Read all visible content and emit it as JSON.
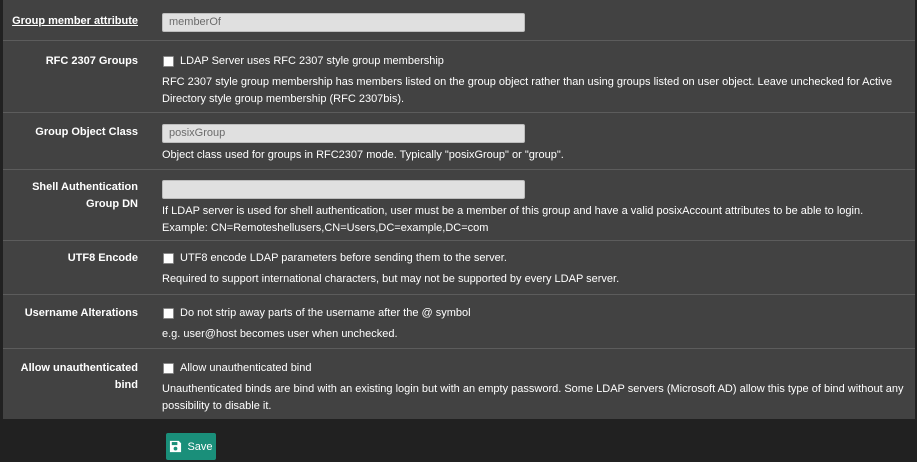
{
  "rows": {
    "group_member_attribute": {
      "label": "Group member attribute",
      "value": "memberOf"
    },
    "rfc2307_groups": {
      "label": "RFC 2307 Groups",
      "checkbox_label": "LDAP Server uses RFC 2307 style group membership",
      "checked": false,
      "help": "RFC 2307 style group membership has members listed on the group object rather than using groups listed on user object. Leave unchecked for Active Directory style group membership (RFC 2307bis)."
    },
    "group_object_class": {
      "label": "Group Object Class",
      "value": "posixGroup",
      "help": "Object class used for groups in RFC2307 mode. Typically \"posixGroup\" or \"group\"."
    },
    "shell_auth_group_dn": {
      "label_line1": "Shell Authentication",
      "label_line2": "Group DN",
      "value": "",
      "help": "If LDAP server is used for shell authentication, user must be a member of this group and have a valid posixAccount attributes to be able to login.",
      "example": "Example: CN=Remoteshellusers,CN=Users,DC=example,DC=com"
    },
    "utf8_encode": {
      "label": "UTF8 Encode",
      "checkbox_label": "UTF8 encode LDAP parameters before sending them to the server.",
      "checked": false,
      "help": "Required to support international characters, but may not be supported by every LDAP server."
    },
    "username_alterations": {
      "label": "Username Alterations",
      "checkbox_label": "Do not strip away parts of the username after the @ symbol",
      "checked": false,
      "help": "e.g. user@host becomes user when unchecked."
    },
    "allow_unauth_bind": {
      "label_line1": "Allow unauthenticated",
      "label_line2": "bind",
      "checkbox_label": "Allow unauthenticated bind",
      "checked": false,
      "help": "Unauthenticated binds are bind with an existing login but with an empty password. Some LDAP servers (Microsoft AD) allow this type of bind without any possibility to disable it."
    }
  },
  "save_button": {
    "label": "Save",
    "icon": "save-icon",
    "color": "#1a8f7a"
  }
}
